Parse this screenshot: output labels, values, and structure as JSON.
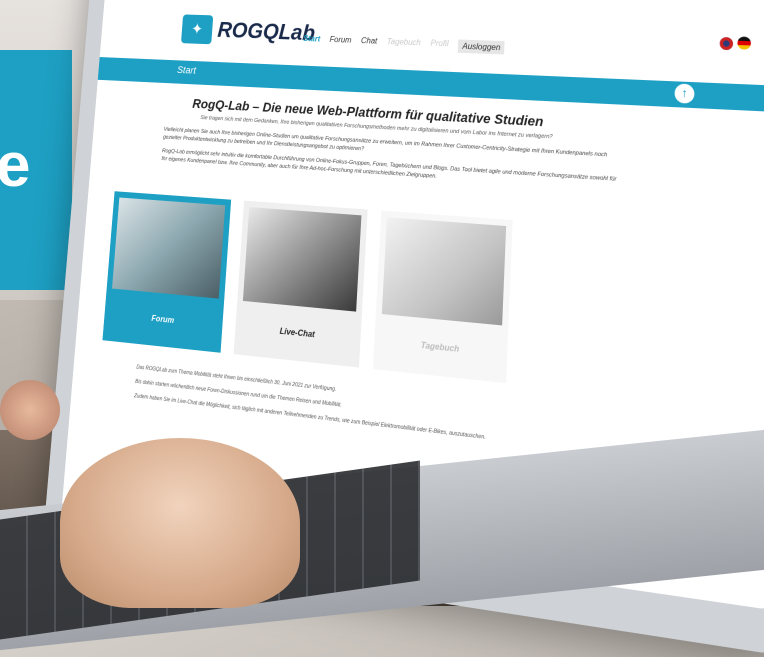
{
  "banner": {
    "text": "e"
  },
  "app": {
    "logo_text": "ROGQLab"
  },
  "nav": {
    "items": [
      {
        "label": "Start",
        "state": "active"
      },
      {
        "label": "Forum",
        "state": "normal"
      },
      {
        "label": "Chat",
        "state": "normal"
      },
      {
        "label": "Tagebuch",
        "state": "disabled"
      },
      {
        "label": "Profil",
        "state": "disabled"
      },
      {
        "label": "Ausloggen",
        "state": "button"
      }
    ]
  },
  "bar": {
    "title": "Start"
  },
  "main": {
    "heading": "RogQ-Lab – Die neue Web-Plattform für qualitative Studien",
    "subheading": "Sie tragen sich mit dem Gedanken, Ihre bisherigen qualitativen Forschungsmethoden mehr zu digitalisieren und vom Labor ins Internet zu verlagern?",
    "paragraph1": "Vielleicht planen Sie auch Ihre bisherigen Online-Studien um qualitative Forschungsansätze zu erweitern, um im Rahmen Ihrer Customer-Centricity-Strategie mit Ihren Kundenpanels noch gezielter Produktentwicklung zu betreiben und Ihr Dienstleistungsangebot zu optimieren?",
    "paragraph2": "RogQ-Lab ermöglicht sehr intuitiv die komfortable Durchführung von Online-Fokus-Gruppen, Foren, Tagebüchern und Blogs. Das Tool bietet agile und moderne Forschungsansätze sowohl für Ihr eigenes Kundenpanel bzw. Ihre Community, aber auch für Ihre Ad-hoc-Forschung mit unterschiedlichen Zielgruppen."
  },
  "cards": [
    {
      "label": "Forum",
      "state": "active"
    },
    {
      "label": "Live-Chat",
      "state": "normal"
    },
    {
      "label": "Tagebuch",
      "state": "disabled"
    }
  ],
  "notes": [
    "Das ROGQLab zum Thema Mobilität steht Ihnen bis einschließlich 30. Juni 2021 zur Verfügung.",
    "Bis dahin starten wöchentlich neue Foren-Diskussionen rund um die Themen Reisen und Mobilität.",
    "Zudem haben Sie im Live-Chat die Möglichkeit, sich täglich mit anderen Teilnehmenden zu Trends, wie zum Beispiel Elektromobilität oder E-Bikes, auszutauschen."
  ],
  "colors": {
    "accent": "#1da0c4",
    "dark": "#1a2a4a"
  }
}
